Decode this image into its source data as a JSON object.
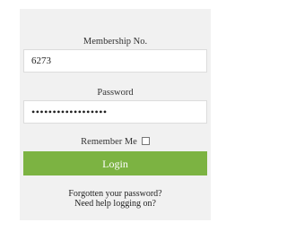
{
  "login_form": {
    "membership_label": "Membership No.",
    "membership_value": "6273",
    "password_label": "Password",
    "password_value": "••••••••••••••••••",
    "remember_label": "Remember Me",
    "remember_checked": false,
    "login_button": "Login",
    "forgot_link": "Forgotten your password?",
    "help_link": "Need help logging on?"
  },
  "colors": {
    "panel_background": "#f1f1f1",
    "button_green": "#7cb342",
    "input_background": "#ffffff"
  }
}
